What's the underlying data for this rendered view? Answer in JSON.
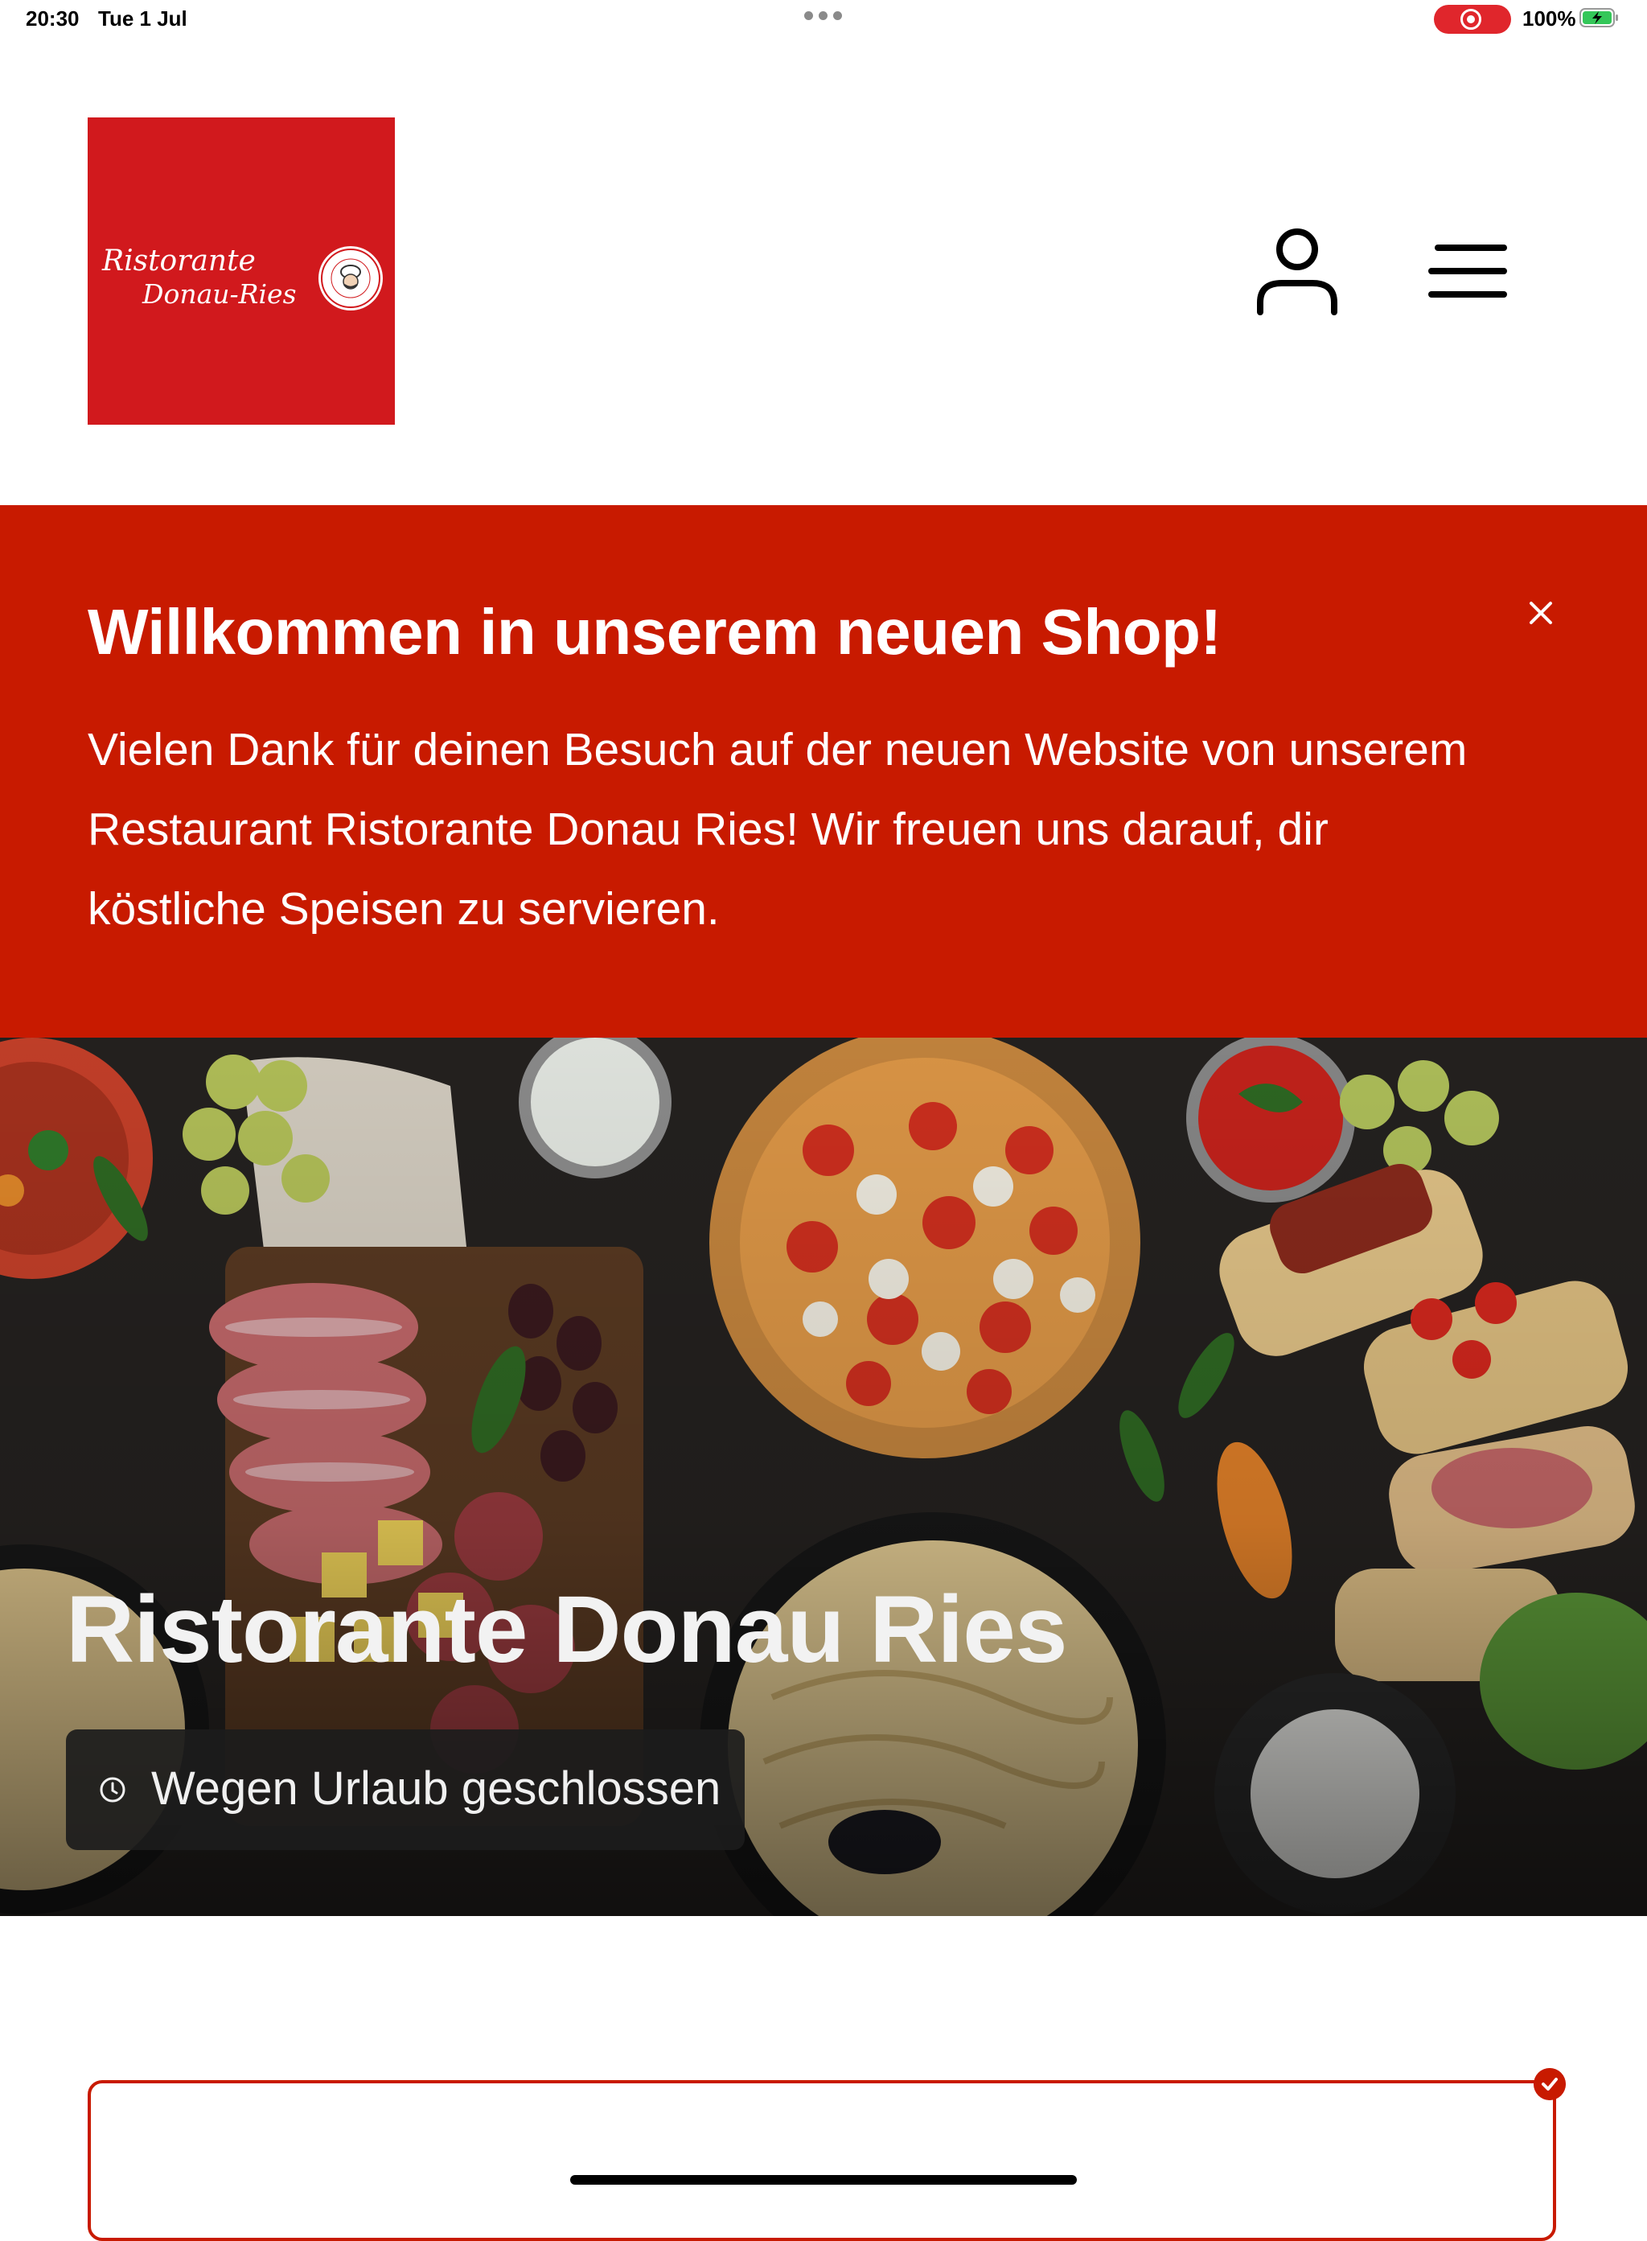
{
  "status_bar": {
    "time": "20:30",
    "date": "Tue 1 Jul",
    "battery": "100%",
    "battery_level": 1.0,
    "screen_recording": true
  },
  "header": {
    "logo": {
      "line1": "Ristorante",
      "line2": "Donau-Ries"
    },
    "account_icon": "person-icon",
    "menu_icon": "hamburger-menu-icon"
  },
  "welcome": {
    "title": "Willkommen in unserem neuen Shop!",
    "body": "Vielen Dank für deinen Besuch auf der neuen Website von unserem Restaurant Ristorante Donau Ries! Wir freuen uns darauf, dir köstliche Speisen zu servieren.",
    "close_icon": "close-icon"
  },
  "hero": {
    "title": "Ristorante Donau Ries",
    "hours_status": "Wegen Urlaub geschlossen",
    "hours_icon": "clock-icon"
  },
  "colors": {
    "brand_red": "#c81a00",
    "logo_red": "#d1191d",
    "pill_bg": "#1c1c1c"
  },
  "card": {
    "check_icon": "checkmark-icon"
  }
}
